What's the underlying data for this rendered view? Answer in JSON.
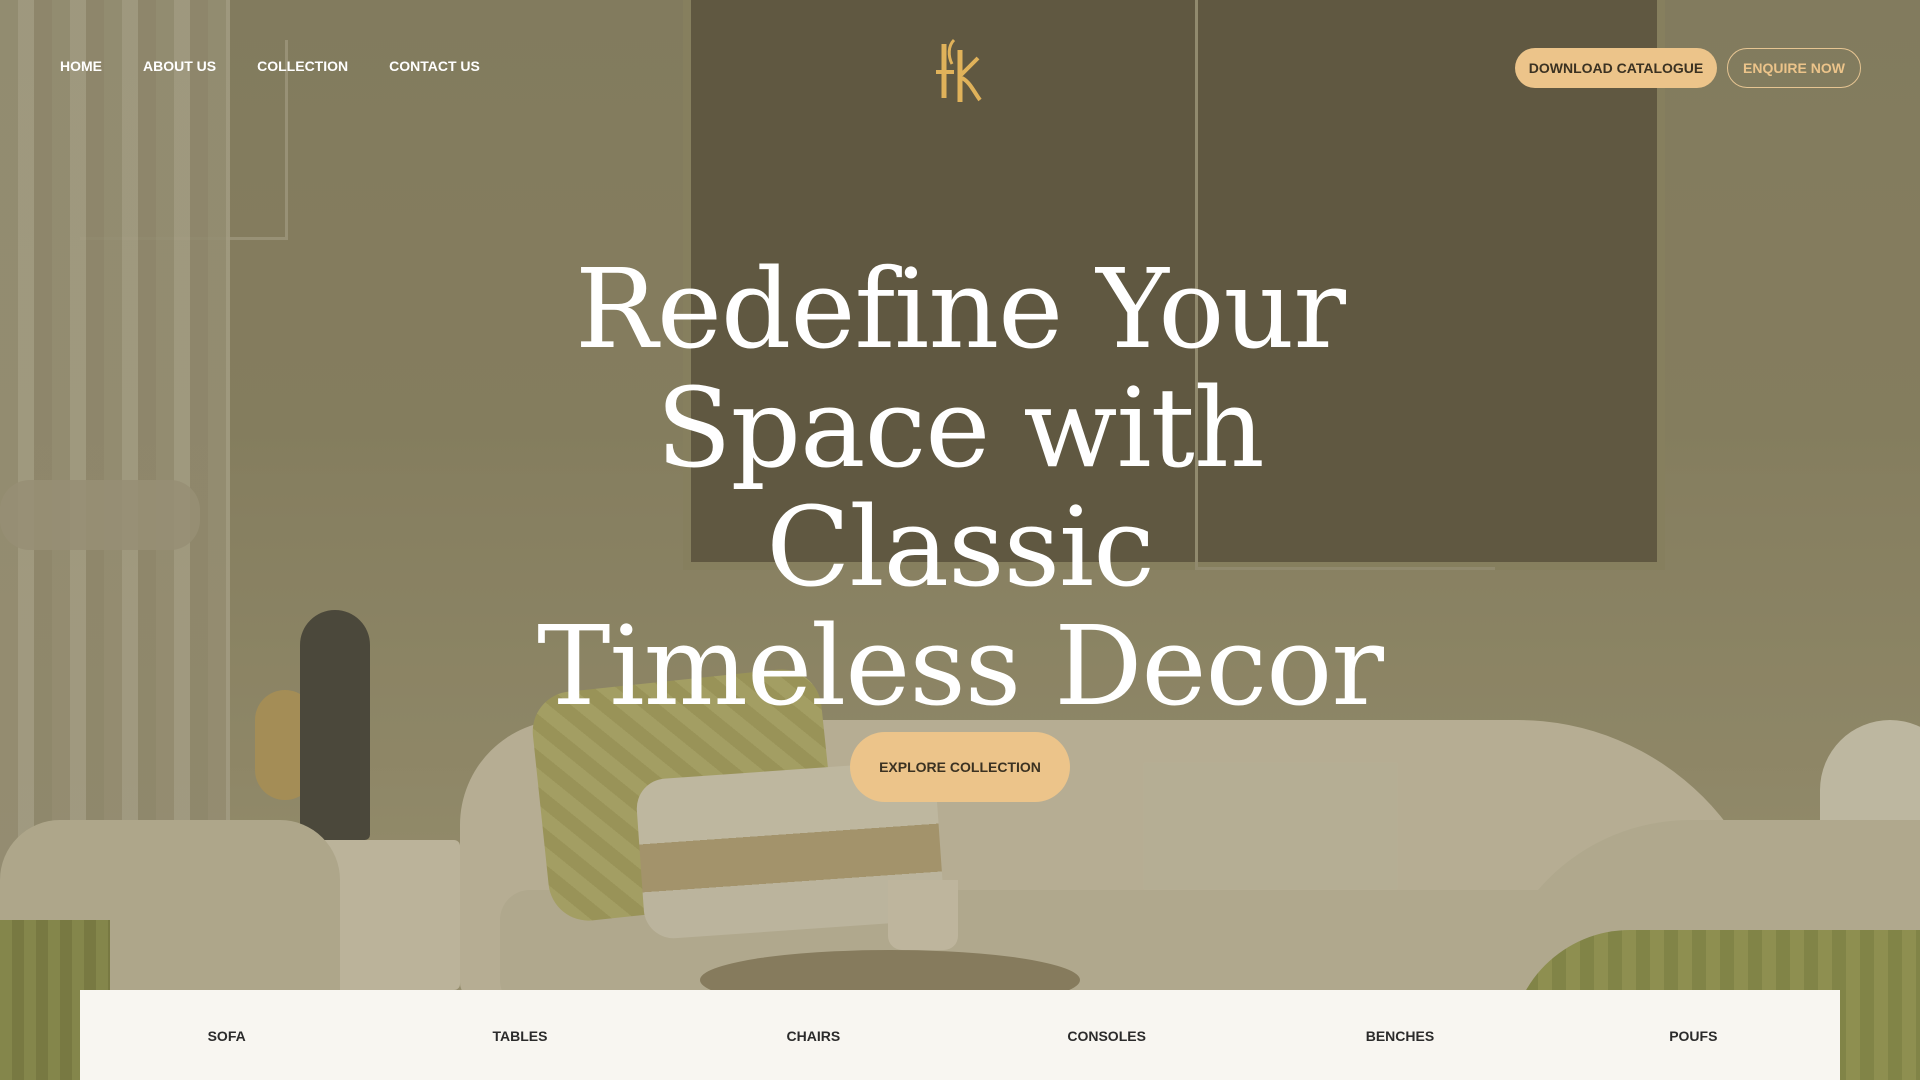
{
  "nav": {
    "items": [
      {
        "label": "HOME"
      },
      {
        "label": "ABOUT US"
      },
      {
        "label": "COLLECTION"
      },
      {
        "label": "CONTACT US"
      }
    ]
  },
  "header": {
    "download_label": "DOWNLOAD CATALOGUE",
    "enquire_label": "ENQUIRE NOW"
  },
  "hero": {
    "headline_lines": [
      "Redefine Your",
      "Space with Classic",
      "Timeless Decor"
    ],
    "cta_label": "EXPLORE COLLECTION"
  },
  "categories": [
    {
      "label": "SOFA"
    },
    {
      "label": "TABLES"
    },
    {
      "label": "CHAIRS"
    },
    {
      "label": "CONSOLES"
    },
    {
      "label": "BENCHES"
    },
    {
      "label": "POUFS"
    }
  ],
  "colors": {
    "accent": "#ecc48a",
    "logo": "#e0b25a"
  }
}
